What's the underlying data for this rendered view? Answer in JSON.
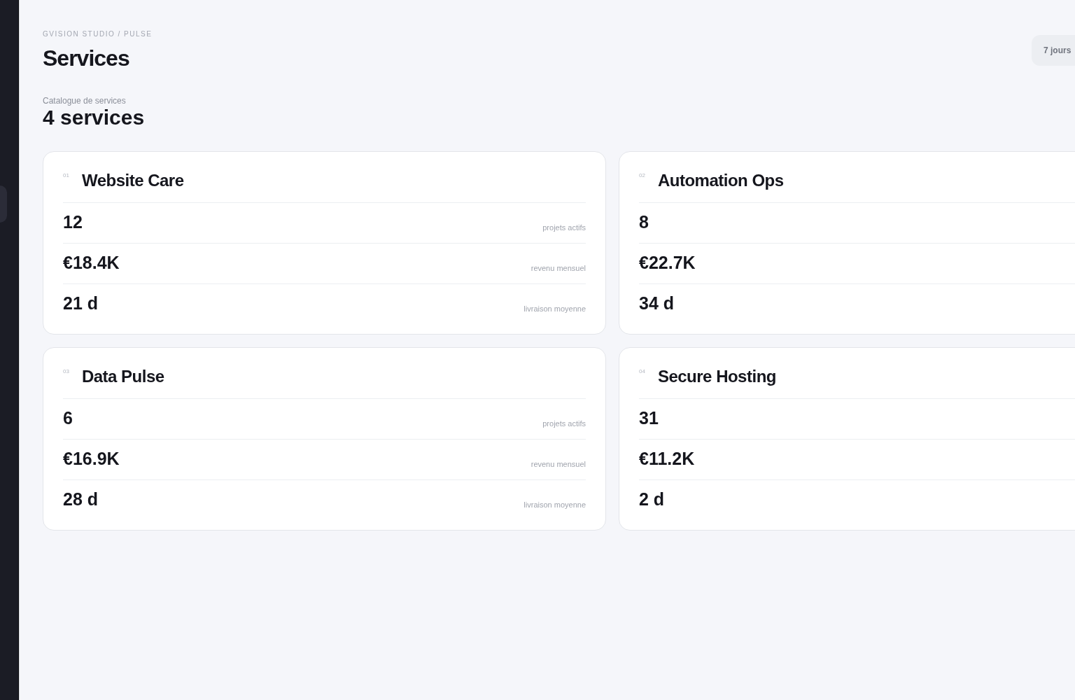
{
  "sidebar": {
    "items": [
      {
        "selected": true
      }
    ]
  },
  "header": {
    "breadcrumb": "GVISION STUDIO / PULSE",
    "title": "Services",
    "period_button": "7 jours"
  },
  "catalogue": {
    "caption": "Catalogue de services",
    "count": "4 services"
  },
  "services": [
    {
      "number": "01",
      "name": "Website Care",
      "metrics": [
        {
          "value": "12",
          "label": "projets actifs"
        },
        {
          "value": "€18.4K",
          "label": "revenu mensuel"
        },
        {
          "value": "21 d",
          "label": "livraison moyenne"
        }
      ]
    },
    {
      "number": "02",
      "name": "Automation Ops",
      "metrics": [
        {
          "value": "8"
        },
        {
          "value": "€22.7K"
        },
        {
          "value": "34 d"
        }
      ]
    },
    {
      "number": "03",
      "name": "Data Pulse",
      "metrics": [
        {
          "value": "6",
          "label": "projets actifs"
        },
        {
          "value": "€16.9K",
          "label": "revenu mensuel"
        },
        {
          "value": "28 d",
          "label": "livraison moyenne"
        }
      ]
    },
    {
      "number": "04",
      "name": "Secure Hosting",
      "metrics": [
        {
          "value": "31"
        },
        {
          "value": "€11.2K"
        },
        {
          "value": "2 d"
        }
      ]
    }
  ]
}
